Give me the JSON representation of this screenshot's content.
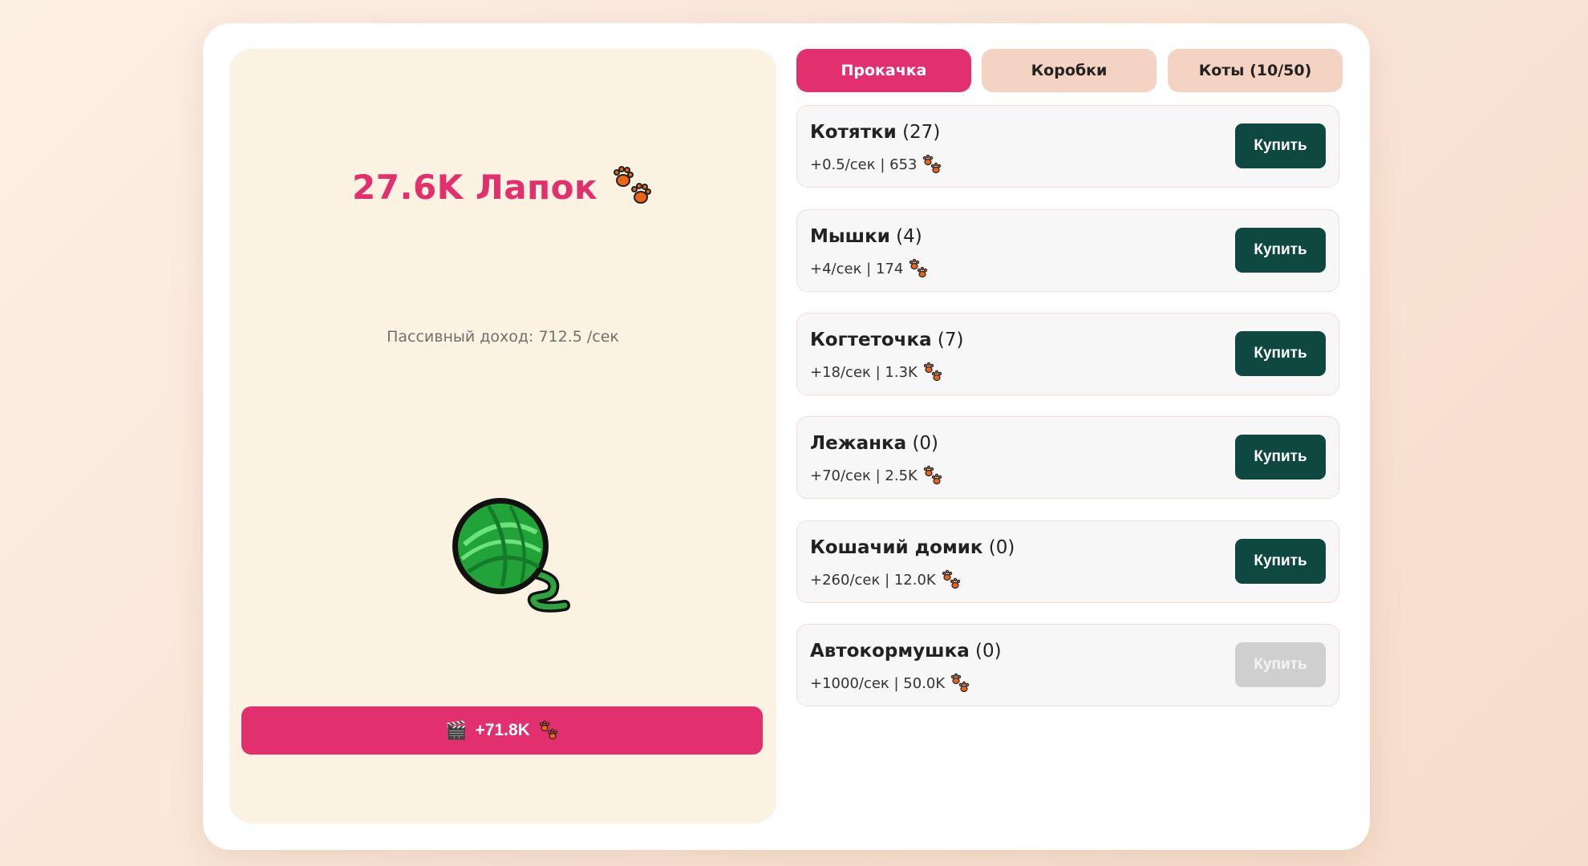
{
  "game": {
    "score_text": "27.6K Лапок",
    "passive_income_text": "Пассивный доход: 712.5 /сек",
    "ad_reward_text": "+71.8K",
    "colors": {
      "accent": "#e2306e",
      "buy_button": "#0e4840",
      "buy_disabled": "#cfcfcf",
      "tab_inactive": "#f4d3c2",
      "left_panel": "#fcf2e2"
    }
  },
  "tabs": [
    {
      "label": "Прокачка",
      "active": true
    },
    {
      "label": "Коробки",
      "active": false
    },
    {
      "label": "Коты (10/50)",
      "active": false
    }
  ],
  "shop": [
    {
      "name": "Котятки",
      "count": "(27)",
      "stats": "+0.5/сек | 653",
      "buy": "Купить",
      "enabled": true
    },
    {
      "name": "Мышки",
      "count": "(4)",
      "stats": "+4/сек | 174",
      "buy": "Купить",
      "enabled": true
    },
    {
      "name": "Когтеточка",
      "count": "(7)",
      "stats": "+18/сек | 1.3K",
      "buy": "Купить",
      "enabled": true
    },
    {
      "name": "Лежанка",
      "count": "(0)",
      "stats": "+70/сек | 2.5K",
      "buy": "Купить",
      "enabled": true
    },
    {
      "name": "Кошачий домик",
      "count": "(0)",
      "stats": "+260/сек | 12.0K",
      "buy": "Купить",
      "enabled": true
    },
    {
      "name": "Автокормушка",
      "count": "(0)",
      "stats": "+1000/сек | 50.0K",
      "buy": "Купить",
      "enabled": false
    }
  ],
  "icons": {
    "currency": "paw-prints-icon",
    "clicker": "yarn-ball-icon",
    "ad": "clapperboard-icon"
  }
}
